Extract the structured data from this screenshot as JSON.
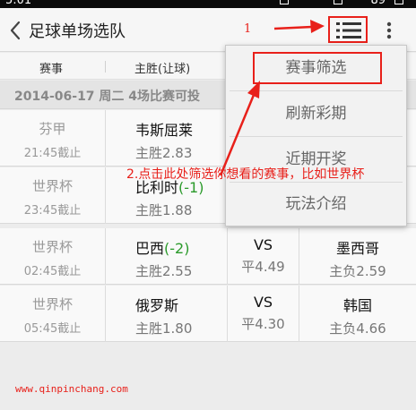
{
  "status_bar": {
    "time": "5:01",
    "battery": "89"
  },
  "header": {
    "title": "足球单场选队",
    "menu_icon": "list-menu-icon",
    "more_icon": "vertical-dots-icon",
    "back_icon": "chevron-left-icon"
  },
  "table_header": {
    "col1": "赛事",
    "col2": "主胜(让球)"
  },
  "date_bar": "2014-06-17 周二  4场比赛可投",
  "matches": [
    {
      "league": "芬甲",
      "deadline": "21:45截止",
      "home": "韦斯屈莱",
      "handicap": "",
      "home_odds": "主胜2.83",
      "vs": "",
      "draw_odds": "",
      "away": "",
      "away_odds": ""
    },
    {
      "league": "世界杯",
      "deadline": "23:45截止",
      "home": "比利时",
      "handicap": "(-1)",
      "home_odds": "主胜1.88",
      "vs": "",
      "draw_odds": "",
      "away": "",
      "away_odds": ""
    },
    {
      "league": "世界杯",
      "deadline": "02:45截止",
      "home": "巴西",
      "handicap": "(-2)",
      "home_odds": "主胜2.55",
      "vs": "VS",
      "draw_odds": "平4.49",
      "away": "墨西哥",
      "away_odds": "主负2.59"
    },
    {
      "league": "世界杯",
      "deadline": "05:45截止",
      "home": "俄罗斯",
      "handicap": "",
      "home_odds": "主胜1.80",
      "vs": "VS",
      "draw_odds": "平4.30",
      "away": "韩国",
      "away_odds": "主负4.66"
    }
  ],
  "dropdown": {
    "items": [
      "赛事筛选",
      "刷新彩期",
      "近期开奖",
      "玩法介绍"
    ]
  },
  "annotations": {
    "number": "1",
    "instruction": "2.点击此处筛选你想看的赛事，比如世界杯",
    "watermark": "www.qinpinchang.com",
    "color": "#e8201a"
  },
  "colors": {
    "handicap_green": "#2a9a2a",
    "accent_red": "#e8201a"
  }
}
